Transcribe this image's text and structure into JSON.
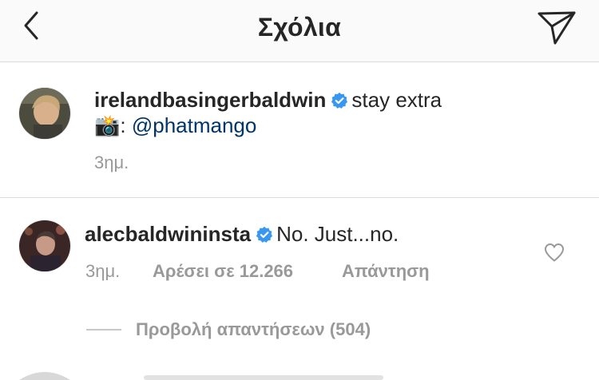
{
  "header": {
    "title": "Σχόλια",
    "back_icon": "chevron-left-icon",
    "share_icon": "paper-plane-icon"
  },
  "caption": {
    "username": "irelandbasingerbaldwin",
    "text": "stay extra",
    "camera_emoji": "📸",
    "colon": ":",
    "mention": "@phatmango",
    "time": "3ημ."
  },
  "comment": {
    "username": "alecbaldwininsta",
    "text": "No. Just...no.",
    "time": "3ημ.",
    "likes": "Αρέσει σε 12.266",
    "reply_label": "Απάντηση",
    "view_replies": "Προβολή απαντήσεων (504)"
  },
  "colors": {
    "verified": "#3897f0",
    "mention": "#003569",
    "meta": "#999999",
    "header_bg": "#fafafa"
  }
}
